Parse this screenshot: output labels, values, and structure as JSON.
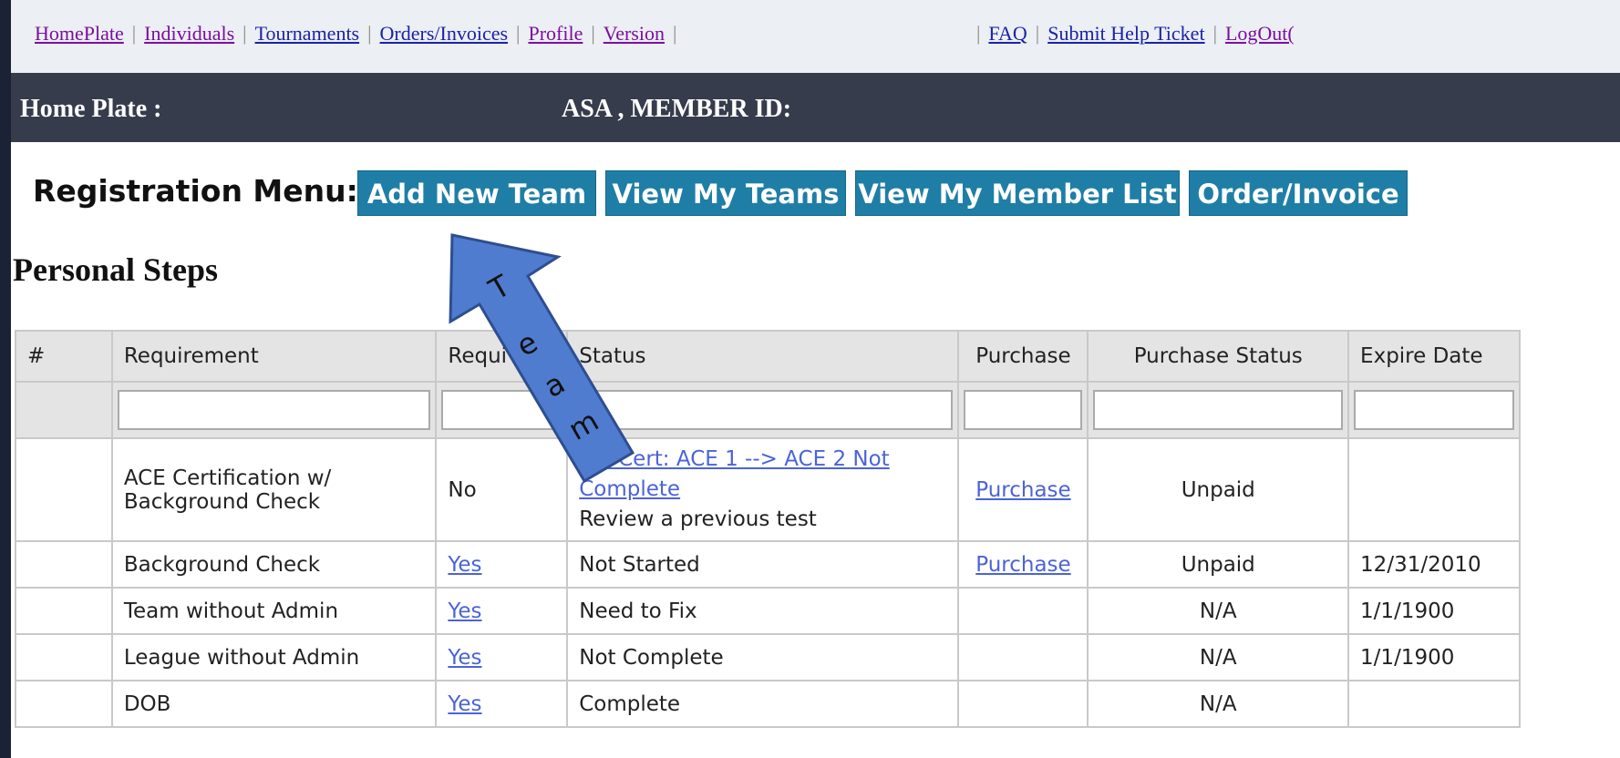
{
  "topnav": {
    "links": [
      "HomePlate",
      "Individuals",
      "Tournaments",
      "Orders/Invoices",
      "Profile",
      "Version"
    ],
    "links_right": [
      "FAQ",
      "Submit Help Ticket",
      "LogOut("
    ]
  },
  "header": {
    "title": "Home Plate :",
    "member": "ASA , MEMBER ID:"
  },
  "registration_menu": {
    "label": "Registration Menu:",
    "buttons": [
      "Add New Team",
      "View My Teams",
      "View My Member List",
      "Order/Invoice"
    ]
  },
  "section_title": "Personal Steps",
  "table": {
    "headers": [
      "#",
      "Requirement",
      "Requi",
      "Status",
      "Purchase",
      "Purchase Status",
      "Expire Date"
    ],
    "rows": [
      {
        "num": "",
        "requirement": "ACE Certification w/ Background Check",
        "required": "No",
        "status_link": "ust Cert: ACE 1 --> ACE 2 Not Complete",
        "status_text": "Review a previous test",
        "purchase": "Purchase",
        "purchase_status": "Unpaid",
        "expire": ""
      },
      {
        "num": "",
        "requirement": "Background Check",
        "required": "Yes",
        "status_text": "Not Started",
        "purchase": "Purchase",
        "purchase_status": "Unpaid",
        "expire": "12/31/2010"
      },
      {
        "num": "",
        "requirement": "Team without Admin",
        "required": "Yes",
        "status_text": "Need to Fix",
        "purchase": "",
        "purchase_status": "N/A",
        "expire": "1/1/1900"
      },
      {
        "num": "",
        "requirement": "League without Admin",
        "required": "Yes",
        "status_text": "Not Complete",
        "purchase": "",
        "purchase_status": "N/A",
        "expire": "1/1/1900"
      },
      {
        "num": "",
        "requirement": "DOB",
        "required": "Yes",
        "status_text": "Complete",
        "purchase": "",
        "purchase_status": "N/A",
        "expire": ""
      }
    ]
  },
  "annotation": {
    "letters": [
      "T",
      "e",
      "a",
      "m"
    ]
  },
  "colors": {
    "menu_button": "#1f7ea6",
    "header_bar": "#363c4b",
    "arrow_fill": "#4f7ccf",
    "link": "#4b63d8"
  }
}
